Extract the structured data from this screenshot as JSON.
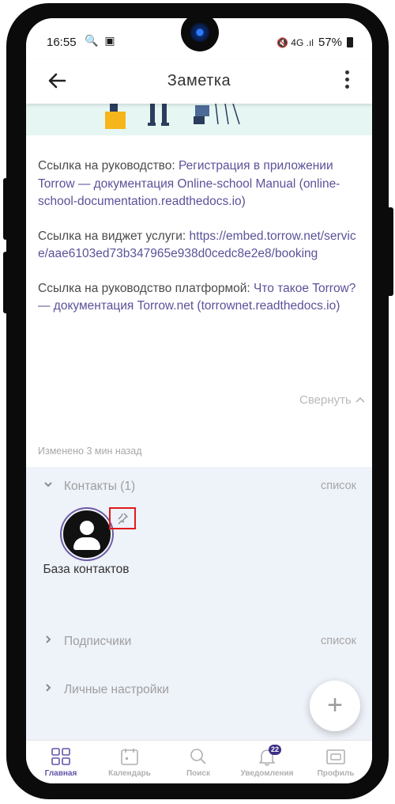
{
  "status_bar": {
    "time": "16:55",
    "left_icons": "🔍 ▣",
    "right_icons": "🔇 4G .ıl",
    "battery": "57%"
  },
  "header": {
    "title": "Заметка",
    "back_icon": "arrow-left-icon",
    "more_icon": "more-vertical-icon"
  },
  "note": {
    "guide_label": "Ссылка на руководство: ",
    "guide_link": "Регистрация в приложении Torrow — документация Online-school Manual (online-school-documentation.readthedocs.io)",
    "widget_label": "Ссылка на виджет услуги: ",
    "widget_link": "https://embed.torrow.net/service/aae6103ed73b347965e938d0cedc8e2e8/booking",
    "platform_label": "Ссылка на руководство платформой: ",
    "platform_link": "Что такое Torrow? — документация Torrow.net (torrownet.readthedocs.io)",
    "collapse_label": "Свернуть",
    "modified": "Изменено 3 мин назад"
  },
  "sections": {
    "contacts": {
      "label": "Контакты (1)",
      "right": "список"
    },
    "contact_item": {
      "label": "База контактов"
    },
    "subscribers": {
      "label": "Подписчики",
      "right": "список"
    },
    "personal": {
      "label": "Личные настройки"
    }
  },
  "fab": {
    "label": "+"
  },
  "tabs": [
    {
      "label": "Главная",
      "icon": "grid-icon",
      "active": true
    },
    {
      "label": "Календарь",
      "icon": "calendar-icon"
    },
    {
      "label": "Поиск",
      "icon": "search-icon"
    },
    {
      "label": "Уведомления",
      "icon": "bell-icon",
      "badge": "22"
    },
    {
      "label": "Профиль",
      "icon": "profile-card-icon"
    }
  ],
  "colors": {
    "accent": "#6453a8",
    "link": "#5a5299",
    "panel_bg": "#eef2f9",
    "highlight": "#e01b1b"
  }
}
